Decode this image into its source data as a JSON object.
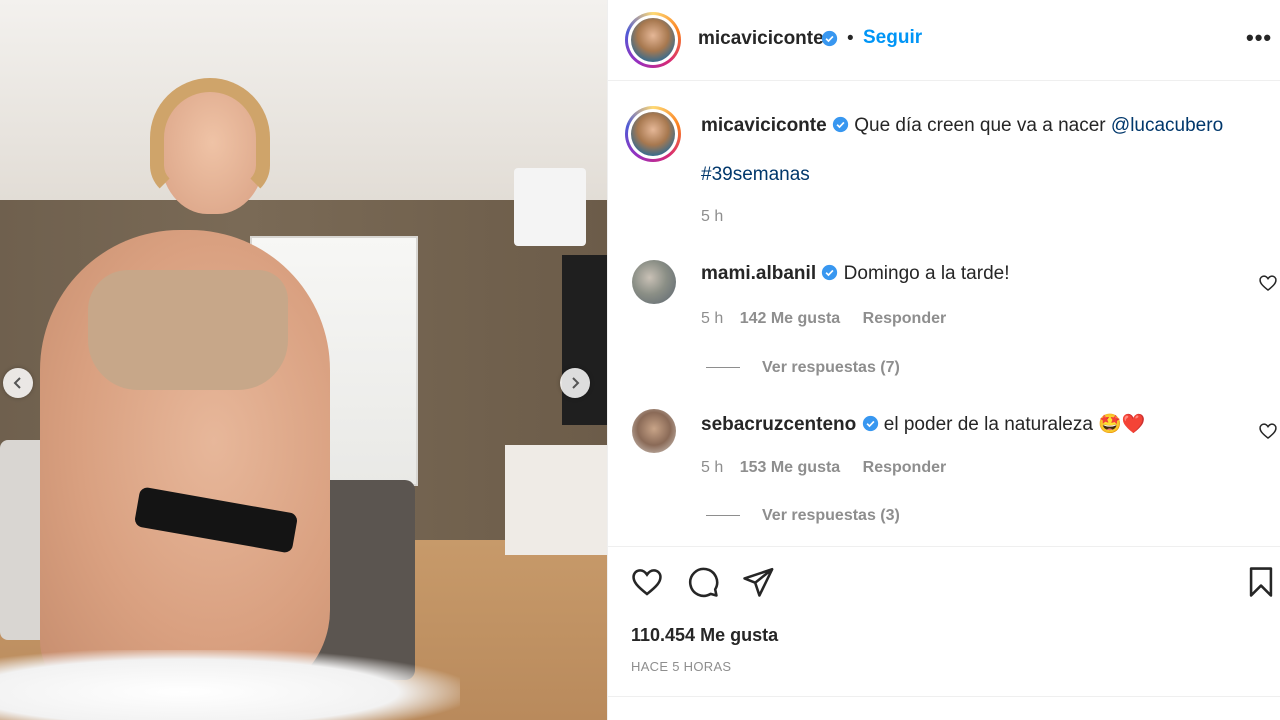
{
  "post": {
    "username": "micaviciconte",
    "verified_icon": "verified-badge-icon",
    "separator": "•",
    "follow_label": "Seguir",
    "more_label": "•••",
    "caption_text": "Que día creen que va a nacer",
    "caption_mention": "@lucacubero",
    "hashtag": "#39semanas",
    "caption_time": "5 h"
  },
  "comments": [
    {
      "username": "mami.albanil",
      "text": "Domingo a la tarde!",
      "time": "5 h",
      "likes": "142 Me gusta",
      "reply_label": "Responder",
      "view_replies": "Ver respuestas (7)"
    },
    {
      "username": "sebacruzcenteno",
      "text": "el poder de la naturaleza",
      "emojis": "🤩❤️",
      "time": "5 h",
      "likes": "153 Me gusta",
      "reply_label": "Responder",
      "view_replies": "Ver respuestas (3)"
    }
  ],
  "footer": {
    "likes_count": "110.454 Me gusta",
    "posted": "HACE 5 HORAS"
  },
  "colors": {
    "accent": "#0095f6",
    "link": "#00376b",
    "muted": "#8e8e8e",
    "text": "#262626",
    "verified": "#3897f0"
  }
}
